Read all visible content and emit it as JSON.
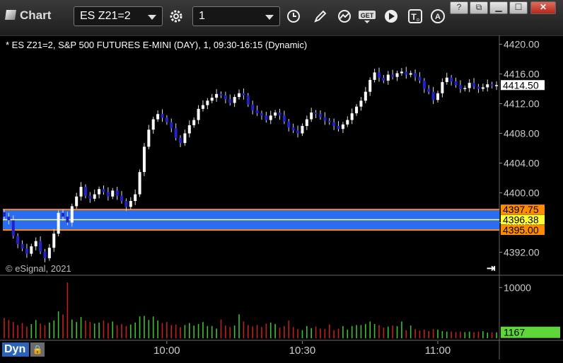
{
  "window": {
    "title": "Chart"
  },
  "toolbar": {
    "symbol": "ES Z21=2",
    "interval": "1",
    "tools": [
      "gear-icon",
      "clock-icon",
      "pencil-icon",
      "study-icon",
      "get-icon",
      "play-icon",
      "text-tool-icon",
      "alert-icon"
    ]
  },
  "chart": {
    "info_line": "* ES Z21=2, S&P 500 FUTURES E-MINI (DAY), 1, 09:30-16:15 (Dynamic)",
    "copyright": "© eSignal, 2021",
    "last_price_label": "4414.50",
    "band_high_label": "4397.75",
    "band_mid_label": "4396.38",
    "band_low_label": "4395.00",
    "volume_label": "1167",
    "mode": "Dyn"
  },
  "colors": {
    "up": "#ffffff",
    "down": "#2222cc",
    "band": "#2b6df0",
    "band_edge": "#ff8c00",
    "vol_up": "#3fbf2f",
    "vol_down": "#c02020",
    "last_vol": "#5ed63a"
  },
  "chart_data": {
    "type": "candlestick",
    "price_axis": {
      "min": 4389,
      "max": 4421,
      "ticks": [
        "4420.00",
        "4416.00",
        "4412.00",
        "4408.00",
        "4404.00",
        "4400.00",
        "4396.00",
        "4392.00"
      ]
    },
    "volume_axis": {
      "max": 12000,
      "ticks": [
        "10000"
      ]
    },
    "time_ticks": [
      "10:00",
      "10:30",
      "11:00"
    ],
    "band": {
      "high": 4397.75,
      "mid": 4396.38,
      "low": 4395.0
    },
    "last_price": 4414.5,
    "closes": [
      4396.8,
      4396.3,
      4394.2,
      4393.1,
      4392.5,
      4391.8,
      4392.8,
      4393.5,
      4392.1,
      4391.2,
      4392.6,
      4394.5,
      4397.3,
      4396.8,
      4396.0,
      4398.2,
      4399.5,
      4400.8,
      4399.6,
      4399.2,
      4399.8,
      4400.5,
      4400.1,
      4399.5,
      4400.3,
      4399.6,
      4398.9,
      4398.1,
      4398.9,
      4399.8,
      4402.8,
      4406.2,
      4408.5,
      4409.9,
      4410.6,
      4410.1,
      4409.5,
      4408.7,
      4407.4,
      4406.7,
      4408.0,
      4409.1,
      4409.8,
      4411.3,
      4411.8,
      4412.4,
      4412.8,
      4413.3,
      4413.1,
      4412.6,
      4412.1,
      4412.9,
      4413.4,
      4413.1,
      4411.9,
      4411.1,
      4410.7,
      4410.4,
      4409.8,
      4410.4,
      4410.8,
      4410.4,
      4409.6,
      4408.8,
      4408.4,
      4408.0,
      4409.0,
      4409.9,
      4410.8,
      4410.6,
      4410.2,
      4409.7,
      4409.5,
      4409.0,
      4408.6,
      4409.2,
      4409.8,
      4410.7,
      4411.6,
      4412.4,
      4413.6,
      4415.2,
      4416.2,
      4415.5,
      4415.1,
      4415.9,
      4415.6,
      4416.1,
      4416.3,
      4415.9,
      4416.1,
      4415.6,
      4415.1,
      4414.0,
      4413.6,
      4412.5,
      4413.4,
      4414.9,
      4415.5,
      4415.0,
      4414.5,
      4414.0,
      4414.1,
      4414.8,
      4414.3,
      4414.0,
      4414.2,
      4414.6,
      4414.4,
      4414.5
    ],
    "volumes": [
      4000,
      3600,
      3200,
      2600,
      3000,
      2300,
      2800,
      3600,
      2900,
      2600,
      3100,
      3500,
      5300,
      4700,
      11000,
      3700,
      3200,
      4200,
      3500,
      3200,
      2900,
      3100,
      3500,
      3000,
      3300,
      2600,
      2800,
      2400,
      2700,
      3100,
      4300,
      4400,
      3600,
      4300,
      3500,
      3000,
      3200,
      2600,
      2700,
      2200,
      2600,
      3000,
      2500,
      2800,
      3200,
      2400,
      2400,
      1900,
      3700,
      2500,
      2200,
      2500,
      4700,
      3300,
      2600,
      2300,
      2600,
      2200,
      2900,
      3100,
      2800,
      2100,
      2400,
      3500,
      2200,
      1800,
      1600,
      2400,
      2000,
      2300,
      1900,
      1800,
      2700,
      1600,
      1900,
      2400,
      1700,
      2400,
      2600,
      2600,
      2800,
      3300,
      2800,
      2600,
      2100,
      2300,
      2500,
      2400,
      3300,
      1600,
      2500,
      1800,
      1500,
      1700,
      1400,
      1800,
      1700,
      1400,
      1300,
      1300,
      1200,
      1300,
      1200,
      1300,
      1200,
      1300,
      1400,
      1100,
      1200,
      1167
    ]
  }
}
